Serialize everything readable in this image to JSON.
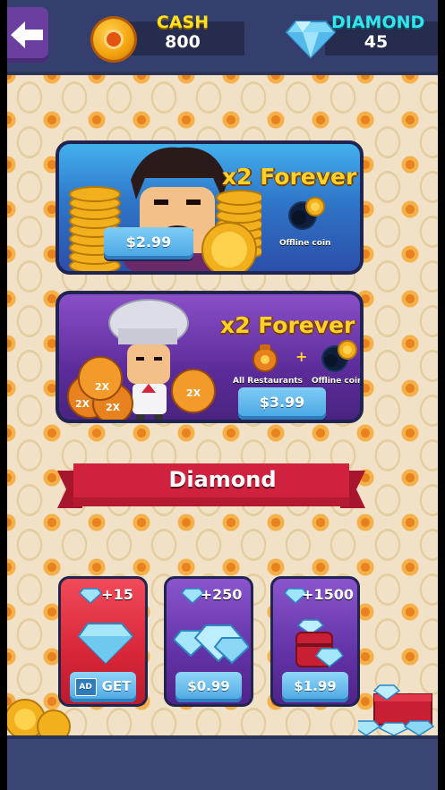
{
  "header": {
    "cash_label": "CASH",
    "cash_value": "800",
    "diamond_label": "DIAMOND",
    "diamond_value": "45"
  },
  "offers": [
    {
      "title": "x2 Forever",
      "sub_label": "Offline coin",
      "price": "$2.99"
    },
    {
      "title": "x2 Forever",
      "sub_label_left": "All Restaurants",
      "plus": "+",
      "sub_label_right": "Offline coin",
      "price": "$3.99"
    }
  ],
  "section_title": "Diamond",
  "packs": [
    {
      "amount": "+15",
      "button_badge": "AD",
      "button_label": "GET"
    },
    {
      "amount": "+250",
      "button_label": "$0.99"
    },
    {
      "amount": "+1500",
      "button_label": "$1.99"
    }
  ],
  "badges": [
    "2X",
    "2X",
    "2X",
    "2X"
  ],
  "colors": {
    "cash": "#ffe11c",
    "diamond": "#2ee8ee",
    "ribbon": "#d0223e"
  }
}
